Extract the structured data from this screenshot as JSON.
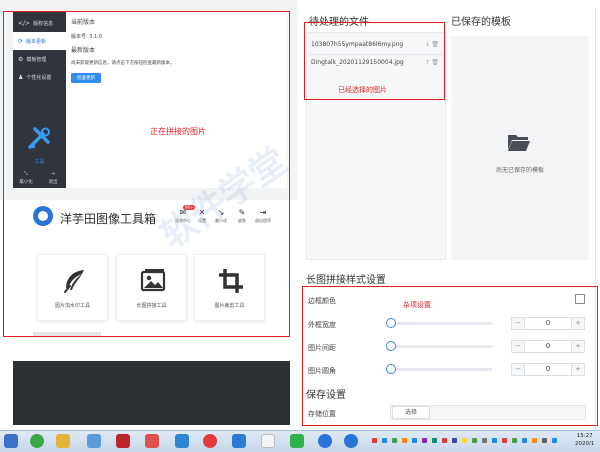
{
  "sidebar": {
    "items": [
      {
        "label": "版权信息",
        "icon": "code-icon"
      },
      {
        "label": "版本更新",
        "icon": "refresh-icon"
      },
      {
        "label": "模板管理",
        "icon": "gear-icon"
      },
      {
        "label": "个性化设置",
        "icon": "user-icon"
      }
    ],
    "tool_label": "工具",
    "min_label": "最小化",
    "exit_label": "退出"
  },
  "about": {
    "current_version_title": "当前版本",
    "version_number": "版本号: 3.1.0",
    "latest_version_title": "最新版本",
    "latest_note": "尚未获取更新信息，请点击下方按钮检查最新版本。",
    "check_button": "检查更新"
  },
  "annotations": {
    "pinning_image": "正在拼接的图片",
    "selected_images": "已经选择的图片",
    "misc_settings": "杂项设置"
  },
  "app": {
    "name": "洋芋田图像工具箱",
    "message_badge": "99+",
    "top_tools": [
      {
        "label": "消息中心",
        "glyph": "✉"
      },
      {
        "label": "设置",
        "glyph": "✕"
      },
      {
        "label": "最小化",
        "glyph": "↘"
      },
      {
        "label": "皮肤",
        "glyph": "✎"
      },
      {
        "label": "退出程序",
        "glyph": "⇥"
      }
    ],
    "cards": [
      {
        "label": "图片加水印工具",
        "icon": "feather-icon"
      },
      {
        "label": "长图拼接工具",
        "icon": "image-icon"
      },
      {
        "label": "图片裁剪工具",
        "icon": "crop-icon"
      }
    ]
  },
  "pending": {
    "title": "待处理的文件",
    "files": [
      {
        "name": "103807h55ympaat86l6my.png"
      },
      {
        "name": "Dingtalk_20201129150004.jpg"
      }
    ]
  },
  "saved": {
    "title": "已保存的模板",
    "empty_text": "尚无已保存的模板"
  },
  "style_settings": {
    "title": "长图拼接样式设置",
    "border_color_label": "边框颜色",
    "border_color_checked": false,
    "rows": [
      {
        "label": "外框宽度",
        "value": "0"
      },
      {
        "label": "图片间距",
        "value": "0"
      },
      {
        "label": "图片圆角",
        "value": "0"
      }
    ]
  },
  "save_settings": {
    "title": "保存设置",
    "storage_label": "存储位置",
    "choose_button": "选择"
  },
  "taskbar": {
    "time": "15:27",
    "date": "2020/1"
  },
  "watermark": "软件学堂",
  "colors": {
    "accent": "#2f8cf0",
    "annotation_red": "#e02020",
    "sidebar_dark": "#30353d"
  }
}
